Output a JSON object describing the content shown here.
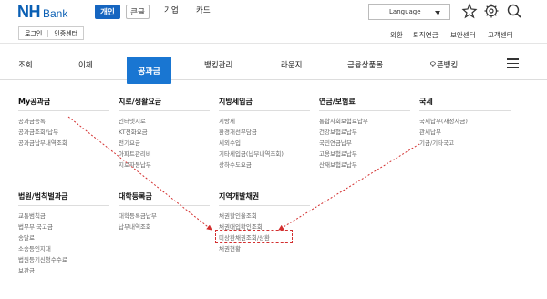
{
  "brand": {
    "nh": "NH",
    "bank": "Bank"
  },
  "segments": {
    "personal": "개인",
    "corporate": "큰글"
  },
  "top_nav": [
    "기업",
    "카드"
  ],
  "language": {
    "label": "Language"
  },
  "login": {
    "login_label": "로그인",
    "cert_label": "인증센터"
  },
  "utility_links": [
    "외환",
    "퇴직연금",
    "보안센터",
    "고객센터"
  ],
  "main_nav": {
    "items": [
      "조회",
      "이체",
      "뱅킹관리",
      "라운지",
      "금융상품몰",
      "오픈뱅킹"
    ],
    "active": "공과금"
  },
  "menu": {
    "my": {
      "title": "My공과금",
      "items": [
        "공과금등록",
        "공과금조회/납부",
        "공과금납부내역조회"
      ]
    },
    "utility": {
      "title": "지로/생활요금",
      "items": [
        "인터넷지로",
        "KT전화요금",
        "전기요금",
        "아파트관리비",
        "지로자동납부"
      ]
    },
    "local_tax": {
      "title": "지방세입금",
      "items": [
        "지방세",
        "환경개선부담금",
        "세외수입",
        "기타세입금(납부내역조회)",
        "상하수도요금"
      ]
    },
    "pension": {
      "title": "연금/보험료",
      "items": [
        "통합사회보험료납부",
        "건강보험료납부",
        "국민연금납부",
        "고용보험료납부",
        "산재보험료납부"
      ]
    },
    "national_tax": {
      "title": "국세",
      "items": [
        "국세납부(재정자금)",
        "관세납부",
        "기금/기타국고"
      ]
    },
    "court": {
      "title": "법원/범칙벌과금",
      "items": [
        "교통범칙금",
        "법무부 국고금",
        "송달료",
        "소송등인지대",
        "법원등기신청수수료",
        "보관금"
      ]
    },
    "tuition": {
      "title": "대학등록금",
      "items": [
        "대학등록금납부",
        "납부내역조회"
      ]
    },
    "regional_bond": {
      "title": "지역개발채권",
      "items": [
        "채권할인율조회",
        "채권매입확인조회",
        "미상환채권조회/상환",
        "채권현황"
      ]
    }
  },
  "annotation": {
    "color": "#d32f2f"
  },
  "icons": [
    "star-icon",
    "gear-icon",
    "search-icon",
    "menu-icon"
  ]
}
